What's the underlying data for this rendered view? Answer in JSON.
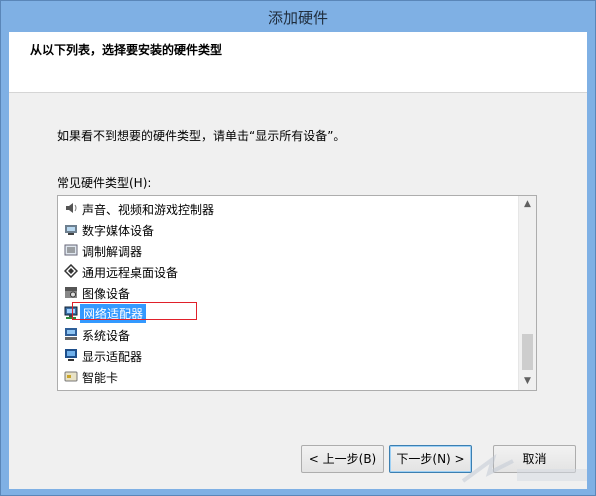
{
  "window": {
    "title": "添加硬件"
  },
  "header": {
    "title": "从以下列表，选择要安装的硬件类型"
  },
  "instruction": "如果看不到想要的硬件类型，请单击“显示所有设备”。",
  "list_label": "常见硬件类型(H):",
  "list_items": [
    {
      "label": "声音、视频和游戏控制器",
      "icon": "speaker-icon"
    },
    {
      "label": "数字媒体设备",
      "icon": "media-device-icon"
    },
    {
      "label": "调制解调器",
      "icon": "modem-icon"
    },
    {
      "label": "通用远程桌面设备",
      "icon": "remote-desktop-icon"
    },
    {
      "label": "图像设备",
      "icon": "camera-icon"
    },
    {
      "label": "网络适配器",
      "icon": "network-adapter-icon",
      "selected": true
    },
    {
      "label": "系统设备",
      "icon": "system-device-icon"
    },
    {
      "label": "显示适配器",
      "icon": "display-adapter-icon"
    },
    {
      "label": "智能卡",
      "icon": "smart-card-icon"
    }
  ],
  "buttons": {
    "back": "< 上一步(B)",
    "next": "下一步(N) >",
    "cancel": "取消"
  },
  "colors": {
    "selection": "#3399ff",
    "highlight_box": "#e0202a",
    "titlebar": "#7fb0e4"
  }
}
